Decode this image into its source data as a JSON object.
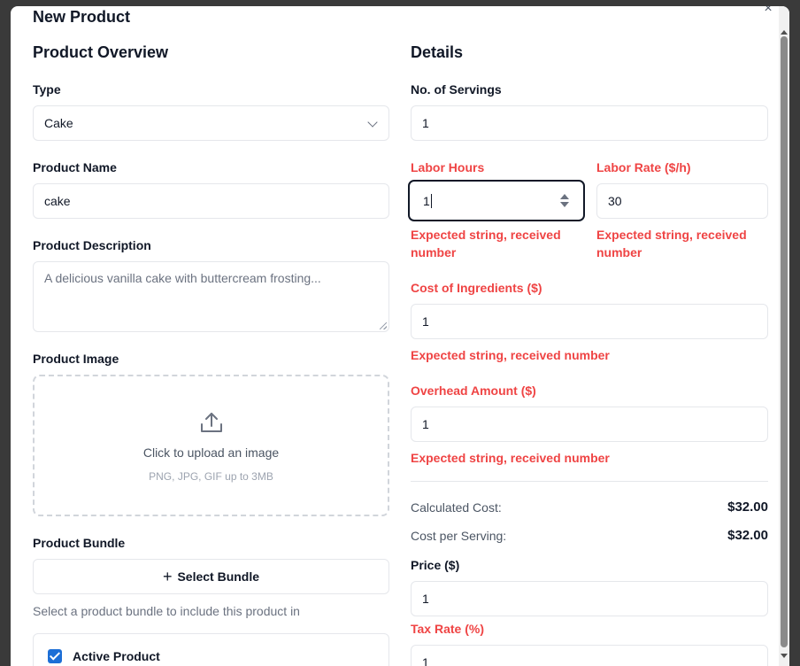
{
  "modal": {
    "title": "New Product",
    "close_icon": "×"
  },
  "overview": {
    "heading": "Product Overview",
    "type_label": "Type",
    "type_value": "Cake",
    "name_label": "Product Name",
    "name_value": "cake",
    "description_label": "Product Description",
    "description_placeholder": "A delicious vanilla cake with buttercream frosting...",
    "image_label": "Product Image",
    "upload_text": "Click to upload an image",
    "upload_hint": "PNG, JPG, GIF up to 3MB",
    "bundle_label": "Product Bundle",
    "bundle_button": "Select Bundle",
    "bundle_helper": "Select a product bundle to include this product in",
    "active_label": "Active Product",
    "active_checked": true
  },
  "details": {
    "heading": "Details",
    "servings_label": "No. of Servings",
    "servings_value": "1",
    "labor_hours_label": "Labor Hours",
    "labor_hours_value": "1",
    "labor_hours_error": "Expected string, received number",
    "labor_rate_label": "Labor Rate ($/h)",
    "labor_rate_value": "30",
    "labor_rate_error": "Expected string, received number",
    "ingredients_label": "Cost of Ingredients ($)",
    "ingredients_value": "1",
    "ingredients_error": "Expected string, received number",
    "overhead_label": "Overhead Amount ($)",
    "overhead_value": "1",
    "overhead_error": "Expected string, received number",
    "calc_cost_label": "Calculated Cost:",
    "calc_cost_value": "$32.00",
    "cost_per_serving_label": "Cost per Serving:",
    "cost_per_serving_value": "$32.00",
    "price_label": "Price ($)",
    "price_value": "1",
    "tax_label": "Tax Rate (%)",
    "tax_value": "1"
  },
  "colors": {
    "error": "#ef4444",
    "checkbox": "#1d6fd6"
  }
}
